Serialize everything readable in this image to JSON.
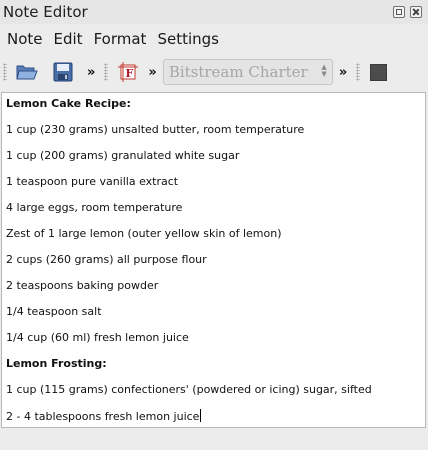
{
  "window": {
    "title": "Note Editor"
  },
  "menu": [
    "Note",
    "Edit",
    "Format",
    "Settings"
  ],
  "toolbar": {
    "font": "Bitstream Charter",
    "overflow": "»"
  },
  "note": {
    "lines": [
      {
        "text": "Lemon Cake Recipe:",
        "bold": true
      },
      {
        "text": "1 cup (230 grams) unsalted butter, room temperature",
        "bold": false
      },
      {
        "text": "1 cup (200 grams) granulated white sugar",
        "bold": false
      },
      {
        "text": "1 teaspoon pure vanilla extract",
        "bold": false
      },
      {
        "text": "4 large eggs, room temperature",
        "bold": false
      },
      {
        "text": "Zest of 1 large lemon (outer yellow skin of lemon)",
        "bold": false
      },
      {
        "text": "2 cups (260 grams) all purpose flour",
        "bold": false
      },
      {
        "text": "2 teaspoons baking powder",
        "bold": false
      },
      {
        "text": "1/4 teaspoon salt",
        "bold": false
      },
      {
        "text": "1/4 cup (60 ml) fresh lemon juice",
        "bold": false
      },
      {
        "text": "Lemon Frosting:",
        "bold": true
      },
      {
        "text": "1 cup (115 grams) confectioners' (powdered or icing) sugar, sifted",
        "bold": false
      },
      {
        "text": "2 - 4 tablespoons fresh lemon juice",
        "bold": false
      }
    ]
  }
}
